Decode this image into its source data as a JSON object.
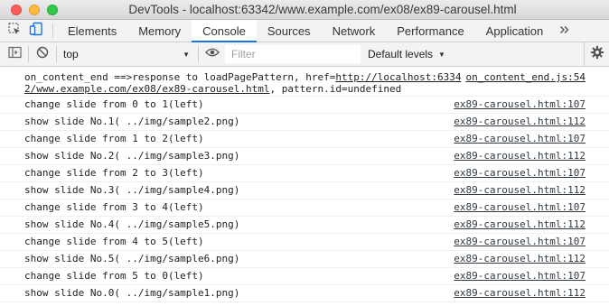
{
  "window": {
    "title": "DevTools - localhost:63342/www.example.com/ex08/ex89-carousel.html"
  },
  "tabs": [
    {
      "label": "Elements",
      "active": false
    },
    {
      "label": "Memory",
      "active": false
    },
    {
      "label": "Console",
      "active": true
    },
    {
      "label": "Sources",
      "active": false
    },
    {
      "label": "Network",
      "active": false
    },
    {
      "label": "Performance",
      "active": false
    },
    {
      "label": "Application",
      "active": false
    }
  ],
  "toolbar": {
    "context": "top",
    "filter_placeholder": "Filter",
    "levels": "Default levels"
  },
  "console": {
    "first": {
      "line1_prefix": "on_content_end ==>response to loadPagePattern, href=",
      "line1_link": "http://localhost:6334",
      "line2_link": "2/www.example.com/ex08/ex89-carousel.html",
      "line2_suffix": ", pattern.id=undefined",
      "source": "on_content_end.js:54"
    },
    "rows": [
      {
        "msg": "change slide from 0 to 1(left)",
        "src": "ex89-carousel.html:107"
      },
      {
        "msg": "show slide No.1( ../img/sample2.png)",
        "src": "ex89-carousel.html:112"
      },
      {
        "msg": "change slide from 1 to 2(left)",
        "src": "ex89-carousel.html:107"
      },
      {
        "msg": "show slide No.2( ../img/sample3.png)",
        "src": "ex89-carousel.html:112"
      },
      {
        "msg": "change slide from 2 to 3(left)",
        "src": "ex89-carousel.html:107"
      },
      {
        "msg": "show slide No.3( ../img/sample4.png)",
        "src": "ex89-carousel.html:112"
      },
      {
        "msg": "change slide from 3 to 4(left)",
        "src": "ex89-carousel.html:107"
      },
      {
        "msg": "show slide No.4( ../img/sample5.png)",
        "src": "ex89-carousel.html:112"
      },
      {
        "msg": "change slide from 4 to 5(left)",
        "src": "ex89-carousel.html:107"
      },
      {
        "msg": "show slide No.5( ../img/sample6.png)",
        "src": "ex89-carousel.html:112"
      },
      {
        "msg": "change slide from 5 to 0(left)",
        "src": "ex89-carousel.html:107"
      },
      {
        "msg": "show slide No.0( ../img/sample1.png)",
        "src": "ex89-carousel.html:112"
      }
    ]
  },
  "colors": {
    "active_tab_underline": "#1a73e8",
    "close": "#fc605c",
    "minimize": "#fdbc40",
    "maximize": "#34c84a"
  },
  "icons": [
    "inspect-element-icon",
    "device-toolbar-icon",
    "more-tabs-chevron-icon",
    "sidebar-toggle-icon",
    "clear-console-icon",
    "eye-icon",
    "settings-gear-icon"
  ]
}
